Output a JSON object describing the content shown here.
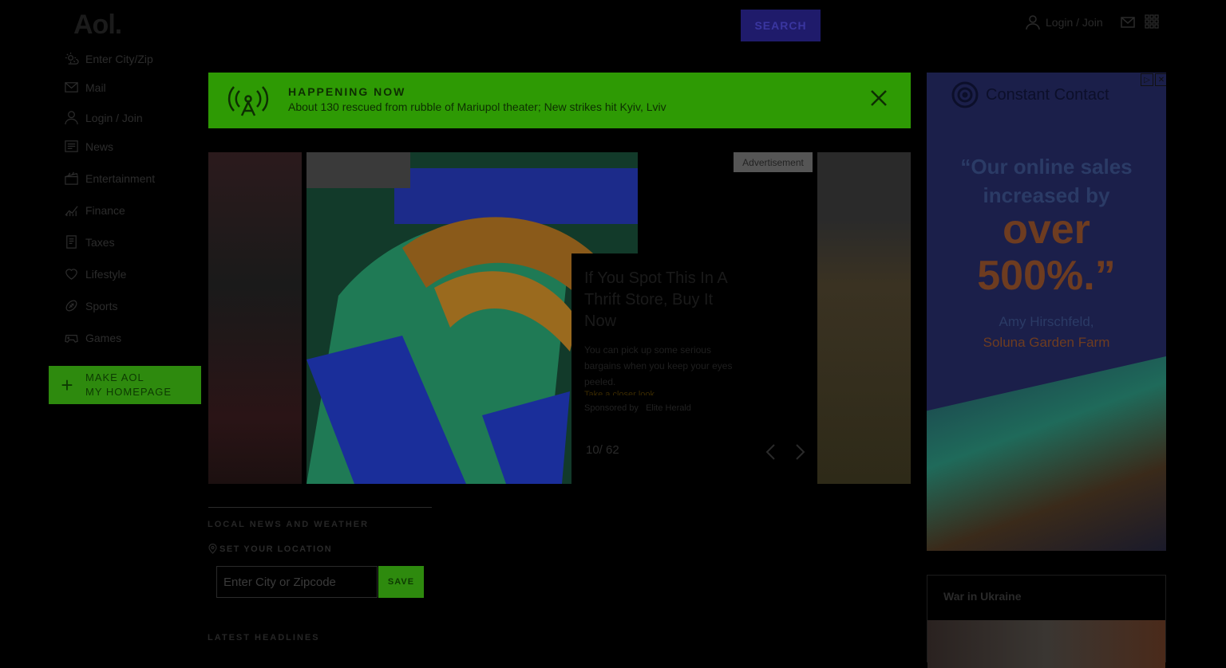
{
  "header": {
    "logo": "Aol.",
    "search_label": "SEARCH",
    "login_label": "Login / Join"
  },
  "sidebar": {
    "items": [
      {
        "label": "Enter City/Zip",
        "icon": "weather-icon"
      },
      {
        "label": "Mail",
        "icon": "mail-icon"
      },
      {
        "label": "Login / Join",
        "icon": "user-icon"
      },
      {
        "label": "News",
        "icon": "news-icon"
      },
      {
        "label": "Entertainment",
        "icon": "clapper-icon"
      },
      {
        "label": "Finance",
        "icon": "chart-icon"
      },
      {
        "label": "Taxes",
        "icon": "document-icon"
      },
      {
        "label": "Lifestyle",
        "icon": "heart-icon"
      },
      {
        "label": "Sports",
        "icon": "football-icon"
      },
      {
        "label": "Games",
        "icon": "gamepad-icon"
      }
    ],
    "homepage_line1": "MAKE AOL",
    "homepage_line2": "MY HOMEPAGE"
  },
  "banner": {
    "kicker": "HAPPENING NOW",
    "headline": "About 130 rescued from rubble of Mariupol theater; New strikes hit Kyiv, Lviv"
  },
  "carousel": {
    "ad_label": "Advertisement",
    "title": "If You Spot This In A Thrift Store, Buy It Now",
    "description": "You can pick up some serious bargains when you keep your eyes peeled.",
    "cta": "Take a closer look",
    "sponsored_by": "Sponsored by",
    "sponsor": "Elite Herald",
    "counter": "10/ 62"
  },
  "local": {
    "heading": "LOCAL NEWS AND WEATHER",
    "set_location": "SET YOUR LOCATION",
    "placeholder": "Enter City or Zipcode",
    "save_label": "SAVE"
  },
  "latest": {
    "heading": "LATEST HEADLINES"
  },
  "ad": {
    "brand": "Constant Contact",
    "quote_line1": "“Our online sales",
    "quote_line2": "increased by",
    "quote_big1": "over",
    "quote_big2": "500%.”",
    "person": "Amy Hirschfeld,",
    "farm": "Soluna Garden Farm"
  },
  "war": {
    "title": "War in Ukraine"
  },
  "colors": {
    "accent_green": "#2e9a04",
    "search_blue": "#1f1b6b",
    "background": "#000000"
  }
}
